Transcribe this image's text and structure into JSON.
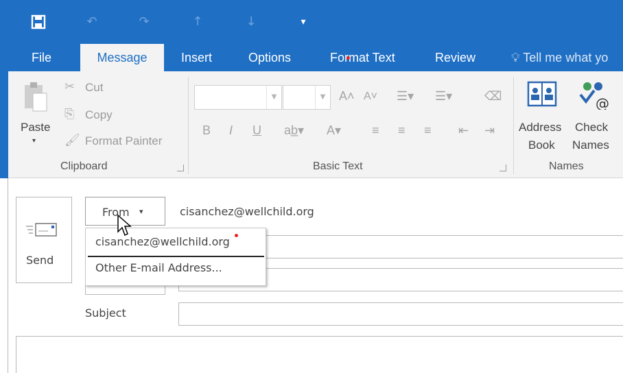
{
  "quick_access": {
    "save_icon": "save-icon",
    "undo_icon": "undo-icon",
    "redo_icon": "redo-icon",
    "up_icon": "up-arrow-icon",
    "down_icon": "down-arrow-icon",
    "customize_icon": "customize-qat-icon"
  },
  "tabs": [
    {
      "label": "File"
    },
    {
      "label": "Message"
    },
    {
      "label": "Insert"
    },
    {
      "label": "Options"
    },
    {
      "label": "Format Text"
    },
    {
      "label": "Review"
    }
  ],
  "tell_me": "Tell me what yo",
  "ribbon": {
    "clipboard": {
      "paste": "Paste",
      "cut": "Cut",
      "copy": "Copy",
      "format_painter": "Format Painter",
      "label": "Clipboard"
    },
    "basic_text": {
      "label": "Basic Text",
      "bold": "B",
      "italic": "I",
      "underline": "U"
    },
    "names": {
      "address_book_1": "Address",
      "address_book_2": "Book",
      "check_names_1": "Check",
      "check_names_2": "Names",
      "label": "Names"
    }
  },
  "compose": {
    "send": "Send",
    "from_label": "From",
    "from_value": "cisanchez@wellchild.org",
    "subject_label": "Subject"
  },
  "from_menu": {
    "items": [
      {
        "label": "cisanchez@wellchild.org"
      },
      {
        "label": "Other E-mail Address..."
      }
    ]
  },
  "colors": {
    "accent": "#1f6fc5",
    "ribbon_bg": "#f3f3f3"
  }
}
